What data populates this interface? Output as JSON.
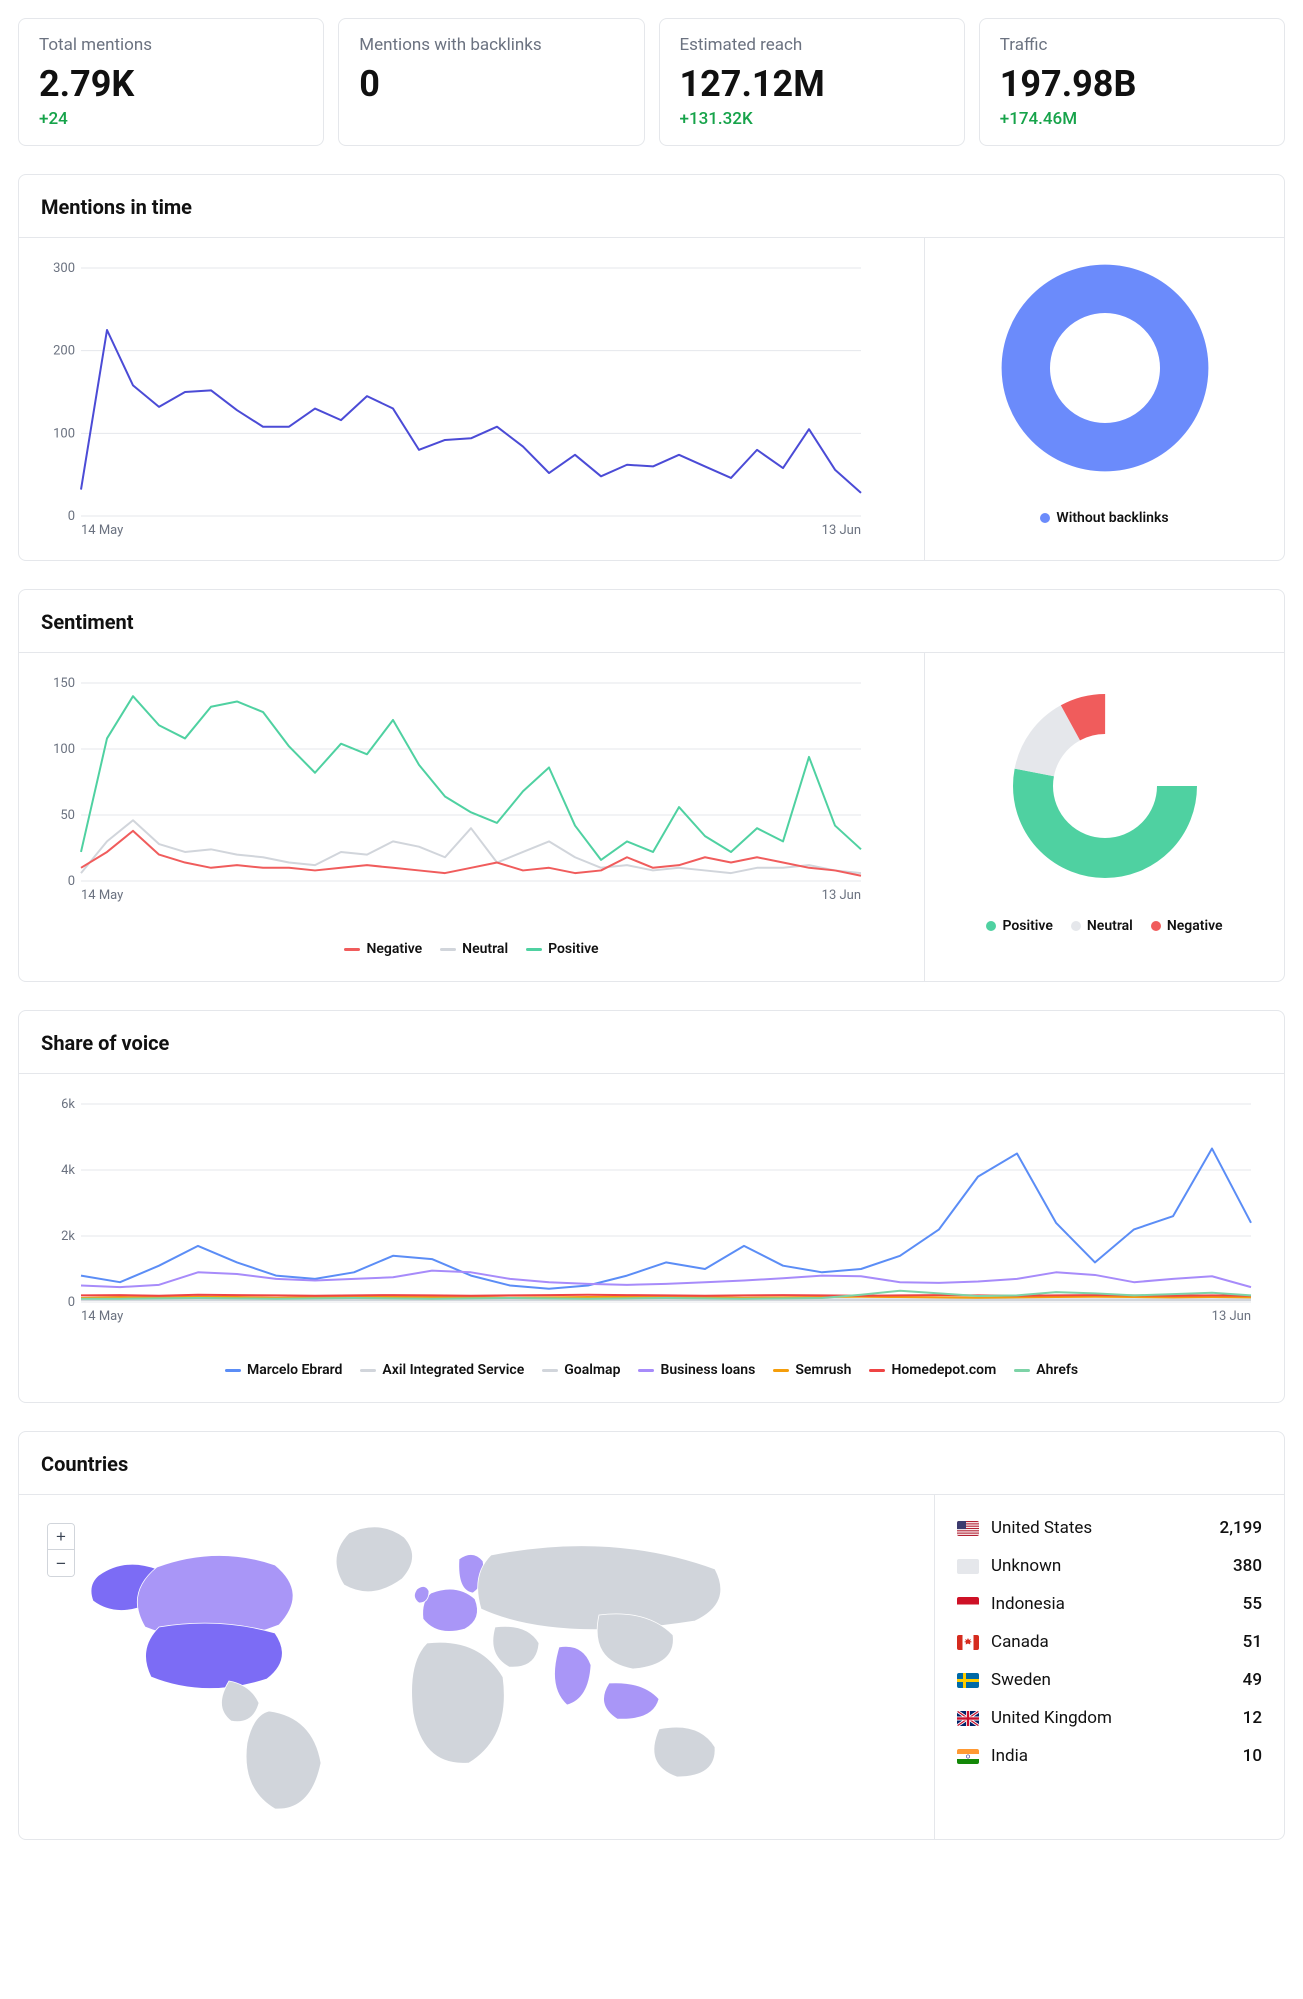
{
  "kpis": [
    {
      "label": "Total mentions",
      "value": "2.79K",
      "delta": "+24"
    },
    {
      "label": "Mentions with backlinks",
      "value": "0",
      "delta": ""
    },
    {
      "label": "Estimated reach",
      "value": "127.12M",
      "delta": "+131.32K"
    },
    {
      "label": "Traffic",
      "value": "197.98B",
      "delta": "+174.46M"
    }
  ],
  "panels": {
    "mentionsInTime": {
      "title": "Mentions in time"
    },
    "sentiment": {
      "title": "Sentiment"
    },
    "shareOfVoice": {
      "title": "Share of voice"
    },
    "countries": {
      "title": "Countries"
    }
  },
  "legends": {
    "withoutBacklinks": "Without backlinks",
    "positive": "Positive",
    "neutral": "Neutral",
    "negative": "Negative"
  },
  "colors": {
    "blue": "#6b8bfb",
    "indigoLine": "#4b4bd6",
    "green": "#4fd1a1",
    "grey": "#d1d5db",
    "red": "#f05c5c",
    "mapFill": "#d1d5db",
    "mapHighlight1": "#7c6cf5",
    "mapHighlight2": "#a996f7",
    "sovBlue": "#5b8df6",
    "sovPurple": "#a78bfa",
    "sovGreen2": "#7dd3a7",
    "sovOrange": "#f59e0b",
    "sovRed": "#ef4444",
    "sovGrey": "#d1d5db"
  },
  "chart_data": [
    {
      "id": "mentions-in-time-line",
      "type": "line",
      "xlabel": "",
      "ylabel": "",
      "ylim": [
        0,
        300
      ],
      "yticks": [
        0,
        100,
        200,
        300
      ],
      "x_range_labels": [
        "14 May",
        "13 Jun"
      ],
      "series": [
        {
          "name": "Mentions",
          "color": "#4b4bd6",
          "values": [
            32,
            225,
            158,
            132,
            150,
            152,
            128,
            108,
            108,
            130,
            116,
            145,
            130,
            80,
            92,
            94,
            108,
            84,
            52,
            74,
            48,
            62,
            60,
            74,
            60,
            46,
            80,
            58,
            105,
            56,
            28
          ]
        }
      ]
    },
    {
      "id": "mentions-in-time-donut",
      "type": "pie",
      "series": [
        {
          "name": "Without backlinks",
          "value": 100,
          "color": "#6b8bfb"
        }
      ]
    },
    {
      "id": "sentiment-line",
      "type": "line",
      "xlabel": "",
      "ylabel": "",
      "ylim": [
        0,
        150
      ],
      "yticks": [
        0,
        50,
        100,
        150
      ],
      "x_range_labels": [
        "14 May",
        "13 Jun"
      ],
      "series": [
        {
          "name": "Positive",
          "color": "#4fd1a1",
          "values": [
            22,
            108,
            140,
            118,
            108,
            132,
            136,
            128,
            102,
            82,
            104,
            96,
            122,
            88,
            64,
            52,
            44,
            68,
            86,
            42,
            16,
            30,
            22,
            56,
            34,
            22,
            40,
            30,
            94,
            42,
            24
          ]
        },
        {
          "name": "Neutral",
          "color": "#d1d5db",
          "values": [
            6,
            30,
            46,
            28,
            22,
            24,
            20,
            18,
            14,
            12,
            22,
            20,
            30,
            26,
            18,
            40,
            14,
            22,
            30,
            18,
            10,
            12,
            8,
            10,
            8,
            6,
            10,
            10,
            12,
            8,
            6
          ]
        },
        {
          "name": "Negative",
          "color": "#f05c5c",
          "values": [
            10,
            22,
            38,
            20,
            14,
            10,
            12,
            10,
            10,
            8,
            10,
            12,
            10,
            8,
            6,
            10,
            14,
            8,
            10,
            6,
            8,
            18,
            10,
            12,
            18,
            14,
            18,
            14,
            10,
            8,
            4
          ]
        }
      ]
    },
    {
      "id": "sentiment-donut",
      "type": "pie",
      "series": [
        {
          "name": "Positive",
          "value": 78,
          "color": "#4fd1a1"
        },
        {
          "name": "Neutral",
          "value": 14,
          "color": "#e5e7eb"
        },
        {
          "name": "Negative",
          "value": 8,
          "color": "#f05c5c"
        }
      ]
    },
    {
      "id": "share-of-voice-line",
      "type": "line",
      "xlabel": "",
      "ylabel": "",
      "ylim": [
        0,
        6000
      ],
      "yticks": [
        0,
        2000,
        4000,
        6000
      ],
      "ytick_labels": [
        "0",
        "2k",
        "4k",
        "6k"
      ],
      "x_range_labels": [
        "14 May",
        "13 Jun"
      ],
      "series": [
        {
          "name": "Marcelo Ebrard",
          "color": "#5b8df6",
          "values": [
            800,
            600,
            1100,
            1700,
            1200,
            800,
            700,
            900,
            1400,
            1300,
            800,
            500,
            400,
            500,
            800,
            1200,
            1000,
            1700,
            1100,
            900,
            1000,
            1400,
            2200,
            3800,
            4500,
            2400,
            1200,
            2200,
            2600,
            4650,
            2400
          ]
        },
        {
          "name": "Axil Integrated Service",
          "color": "#d1d5db",
          "values": [
            80,
            80,
            80,
            80,
            80,
            80,
            80,
            80,
            80,
            80,
            80,
            80,
            80,
            80,
            80,
            80,
            80,
            80,
            80,
            80,
            80,
            80,
            80,
            80,
            80,
            80,
            80,
            80,
            80,
            80,
            80
          ]
        },
        {
          "name": "Goalmap",
          "color": "#d1d5db",
          "values": [
            60,
            60,
            60,
            60,
            60,
            60,
            60,
            60,
            60,
            60,
            60,
            60,
            60,
            60,
            60,
            60,
            60,
            60,
            60,
            60,
            60,
            60,
            60,
            60,
            60,
            60,
            60,
            60,
            60,
            60,
            60
          ]
        },
        {
          "name": "Business loans",
          "color": "#a78bfa",
          "values": [
            500,
            450,
            520,
            900,
            850,
            700,
            650,
            700,
            750,
            950,
            900,
            700,
            600,
            550,
            520,
            550,
            600,
            650,
            720,
            800,
            780,
            600,
            580,
            620,
            700,
            900,
            820,
            600,
            700,
            780,
            450
          ]
        },
        {
          "name": "Semrush",
          "color": "#f59e0b",
          "values": [
            120,
            150,
            140,
            160,
            150,
            130,
            140,
            150,
            160,
            150,
            140,
            130,
            140,
            150,
            160,
            150,
            140,
            130,
            140,
            150,
            160,
            150,
            140,
            130,
            140,
            150,
            160,
            150,
            140,
            150,
            140
          ]
        },
        {
          "name": "Homedepot.com",
          "color": "#ef4444",
          "values": [
            200,
            210,
            190,
            220,
            210,
            200,
            190,
            200,
            210,
            200,
            190,
            200,
            210,
            220,
            210,
            200,
            190,
            200,
            210,
            200,
            190,
            200,
            210,
            200,
            190,
            200,
            210,
            200,
            190,
            200,
            190
          ]
        },
        {
          "name": "Ahrefs",
          "color": "#7dd3a7",
          "values": [
            100,
            100,
            110,
            120,
            110,
            100,
            110,
            120,
            110,
            100,
            110,
            120,
            110,
            100,
            110,
            120,
            110,
            100,
            110,
            120,
            220,
            340,
            260,
            180,
            200,
            300,
            260,
            200,
            240,
            280,
            200
          ]
        }
      ]
    }
  ],
  "sovLegend": [
    {
      "name": "Marcelo Ebrard",
      "color": "#5b8df6"
    },
    {
      "name": "Axil Integrated Service",
      "color": "#d1d5db"
    },
    {
      "name": "Goalmap",
      "color": "#d1d5db"
    },
    {
      "name": "Business loans",
      "color": "#a78bfa"
    },
    {
      "name": "Semrush",
      "color": "#f59e0b"
    },
    {
      "name": "Homedepot.com",
      "color": "#ef4444"
    },
    {
      "name": "Ahrefs",
      "color": "#7dd3a7"
    }
  ],
  "countries": [
    {
      "flag": "us",
      "name": "United States",
      "count": "2,199"
    },
    {
      "flag": "unknown",
      "name": "Unknown",
      "count": "380"
    },
    {
      "flag": "id",
      "name": "Indonesia",
      "count": "55"
    },
    {
      "flag": "ca",
      "name": "Canada",
      "count": "51"
    },
    {
      "flag": "se",
      "name": "Sweden",
      "count": "49"
    },
    {
      "flag": "gb",
      "name": "United Kingdom",
      "count": "12"
    },
    {
      "flag": "in",
      "name": "India",
      "count": "10"
    }
  ]
}
